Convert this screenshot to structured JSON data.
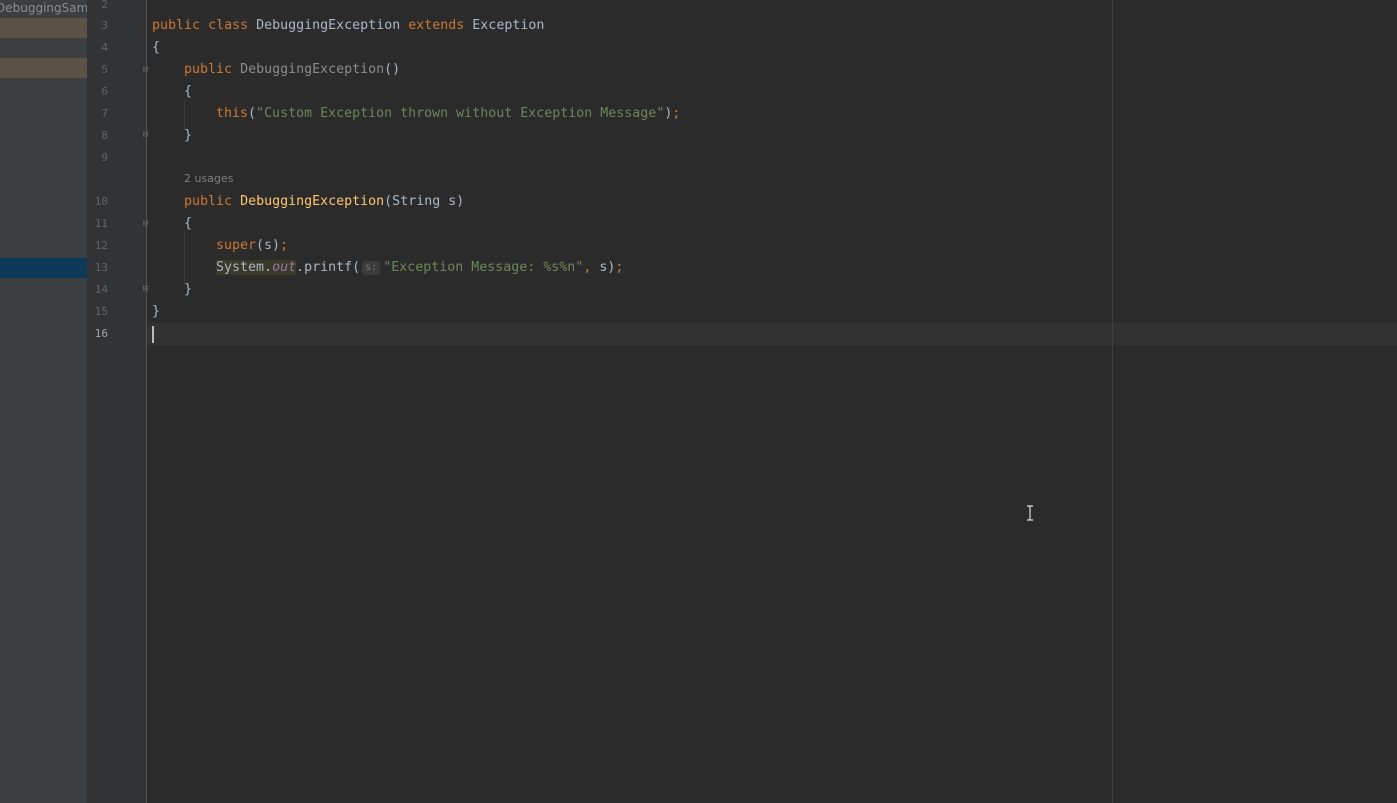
{
  "project_panel": {
    "title": "DebuggingSamples"
  },
  "editor": {
    "usages_hint": "2 usages",
    "param_hint": "s:",
    "line_numbers": [
      "2",
      "3",
      "4",
      "5",
      "6",
      "7",
      "8",
      "9",
      "10",
      "11",
      "12",
      "13",
      "14",
      "15",
      "16"
    ],
    "current_line": "16",
    "code": {
      "l3_public": "public",
      "l3_class": "class",
      "l3_name": "DebuggingException",
      "l3_extends": "extends",
      "l3_super": "Exception",
      "l4": "{",
      "l5_public": "public",
      "l5_ctor": "DebuggingException",
      "l5_parens": "()",
      "l6": "{",
      "l7_this": "this",
      "l7_open": "(",
      "l7_str": "\"Custom Exception thrown without Exception Message\"",
      "l7_close": ")",
      "l7_semi": ";",
      "l8": "}",
      "l10_public": "public",
      "l10_ctor": "DebuggingException",
      "l10_params": "(String s)",
      "l11": "{",
      "l12_super": "super",
      "l12_args": "(s)",
      "l12_semi": ";",
      "l13_system": "System",
      "l13_dot1": ".",
      "l13_out": "out",
      "l13_printf": ".printf(",
      "l13_str": "\"Exception Message: %s%n\"",
      "l13_comma": ",",
      "l13_arg": " s)",
      "l13_semi": ";",
      "l14": "}",
      "l15": "}"
    }
  },
  "colors": {
    "background": "#2b2b2b",
    "keyword": "#cc7832",
    "method": "#ffc66d",
    "string": "#6a8759",
    "text": "#a9b7c6"
  }
}
